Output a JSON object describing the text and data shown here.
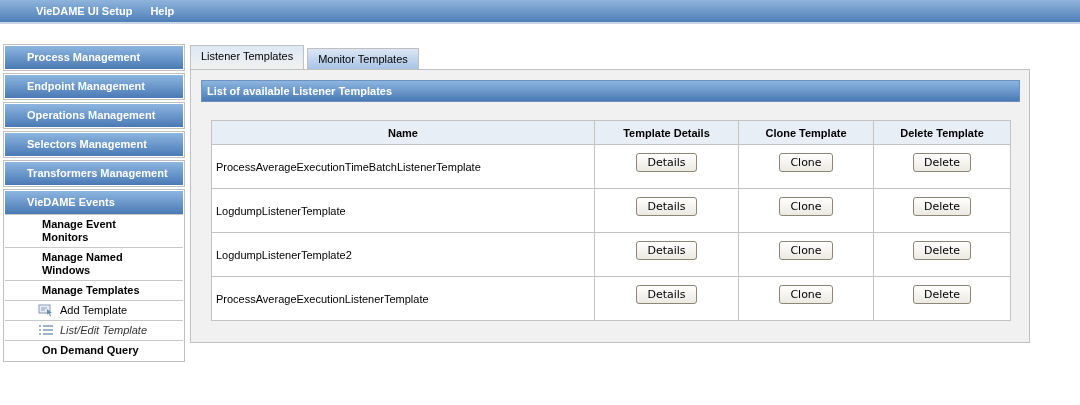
{
  "menu_bar": [
    "VieDAME UI Setup",
    "Help"
  ],
  "sidebar": {
    "items": [
      {
        "kind": "header",
        "label": "Process Management"
      },
      {
        "kind": "header",
        "label": "Endpoint Management"
      },
      {
        "kind": "header",
        "label": "Operations Management"
      },
      {
        "kind": "header",
        "label": "Selectors Management"
      },
      {
        "kind": "header",
        "label": "Transformers Management"
      },
      {
        "kind": "group",
        "label": "VieDAME Events",
        "children": [
          {
            "kind": "link",
            "label": "Manage Event Monitors"
          },
          {
            "kind": "link",
            "label": "Manage Named Windows"
          },
          {
            "kind": "link",
            "label": "Manage Templates"
          },
          {
            "kind": "add-action",
            "label": "Add Template",
            "selected": false
          },
          {
            "kind": "list-action",
            "label": "List/Edit Template",
            "selected": true
          },
          {
            "kind": "link",
            "label": "On Demand Query"
          }
        ]
      }
    ]
  },
  "tabs": [
    {
      "label": "Listener Templates",
      "selected": true
    },
    {
      "label": "Monitor Templates",
      "selected": false
    }
  ],
  "panel": {
    "title": "List of available Listener Templates",
    "table": {
      "columns": [
        "Name",
        "Template Details",
        "Clone Template",
        "Delete Template"
      ],
      "rows": [
        {
          "name": "ProcessAverageExecutionTimeBatchListenerTemplate",
          "buttons": [
            "Details",
            "Clone",
            "Delete"
          ]
        },
        {
          "name": "LogdumpListenerTemplate",
          "buttons": [
            "Details",
            "Clone",
            "Delete"
          ]
        },
        {
          "name": "LogdumpListenerTemplate2",
          "buttons": [
            "Details",
            "Clone",
            "Delete"
          ]
        },
        {
          "name": "ProcessAverageExecutionListenerTemplate",
          "buttons": [
            "Details",
            "Clone",
            "Delete"
          ]
        }
      ]
    }
  }
}
